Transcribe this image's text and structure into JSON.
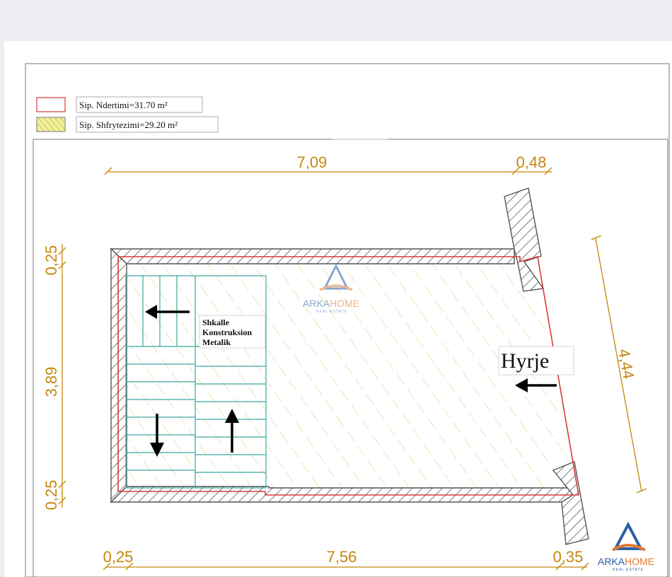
{
  "legend": [
    {
      "label": "Sip. Ndertimi=31.70 m²",
      "swatch": "outline-red"
    },
    {
      "label": "Sip. Shfrytezimi=29.20 m²",
      "swatch": "hatch-yellow"
    }
  ],
  "dimensions": {
    "top_main": "7,09",
    "top_side": "0,48",
    "left_top": "0,25",
    "left_mid": "3,89",
    "left_bottom": "0,25",
    "bottom_left": "0,25",
    "bottom_main": "7,56",
    "bottom_right": "0,35",
    "right_diag": "4,44"
  },
  "stair_note": [
    "Shkalle",
    "Konstruksion",
    "Metalik"
  ],
  "entrance_label": "Hyrje",
  "watermark": {
    "brand_a": "ARKA",
    "brand_b": "HOME",
    "sub": "REAL ESTATE"
  },
  "colors": {
    "wall_outline": "#555555",
    "boundary_red": "#d83a3a",
    "hatch_yellow": "#c9c95a",
    "dimension_orange": "#c5860e",
    "stairs_teal": "#3aa8a0",
    "logo_blue": "#2b5fa8",
    "logo_orange": "#e07a2e"
  }
}
